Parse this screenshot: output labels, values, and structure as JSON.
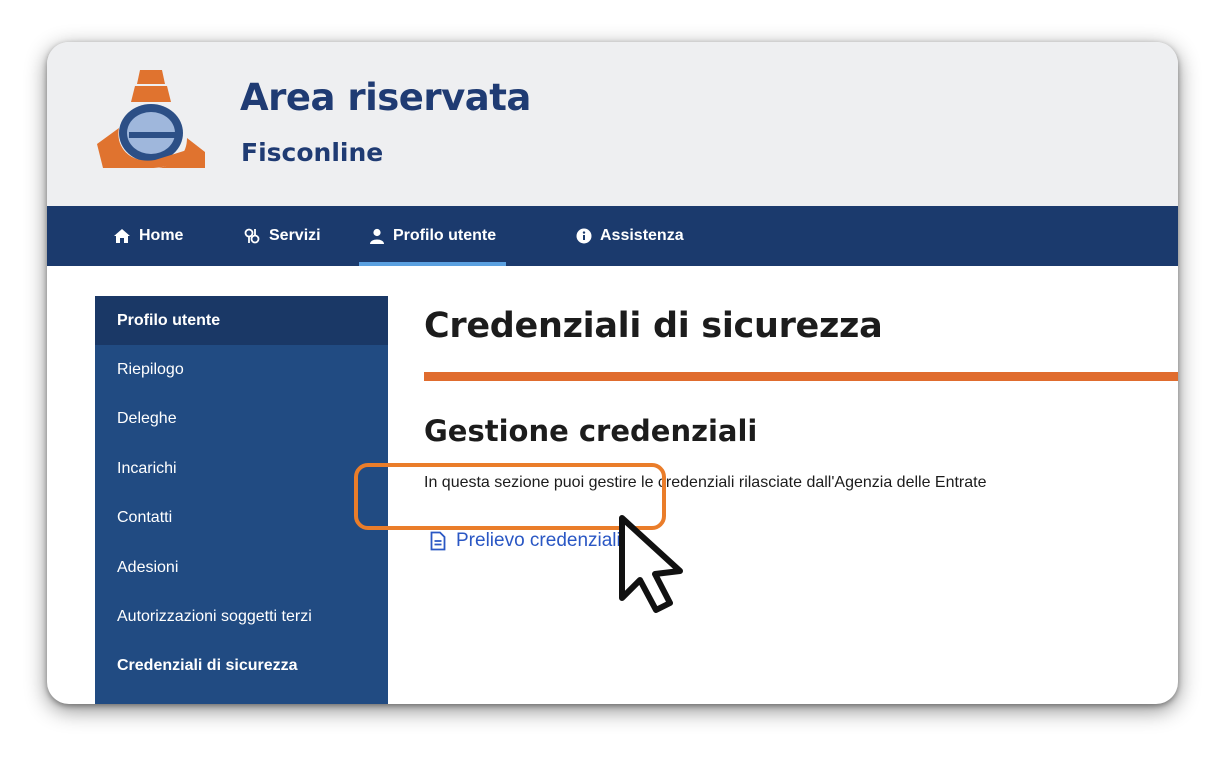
{
  "header": {
    "title": "Area riservata",
    "subtitle": "Fisconline",
    "logo_icon": "agenzia-entrate-logo"
  },
  "nav": {
    "items": [
      {
        "label": "Home",
        "icon": "home-icon"
      },
      {
        "label": "Servizi",
        "icon": "services-icon"
      },
      {
        "label": "Profilo utente",
        "icon": "user-icon",
        "active": true
      },
      {
        "label": "Assistenza",
        "icon": "info-icon"
      }
    ]
  },
  "sidebar": {
    "items": [
      {
        "label": "Profilo utente"
      },
      {
        "label": "Riepilogo"
      },
      {
        "label": "Deleghe"
      },
      {
        "label": "Incarichi"
      },
      {
        "label": "Contatti"
      },
      {
        "label": "Adesioni"
      },
      {
        "label": "Autorizzazioni soggetti terzi"
      },
      {
        "label": "Credenziali di sicurezza",
        "active": true
      }
    ]
  },
  "main": {
    "page_title": "Credenziali di sicurezza",
    "section_title": "Gestione credenziali",
    "description": "In questa sezione puoi gestire le credenziali rilasciate dall'Agenzia delle Entrate",
    "link_label": "Prelievo credenziali",
    "link_icon": "document-icon",
    "link_arrow_icon": "arrow-right-icon"
  },
  "colors": {
    "brand_blue": "#1b3a6d",
    "sidebar_blue": "#214b82",
    "accent_orange": "#e06c2e",
    "link_blue": "#2a57c4"
  }
}
